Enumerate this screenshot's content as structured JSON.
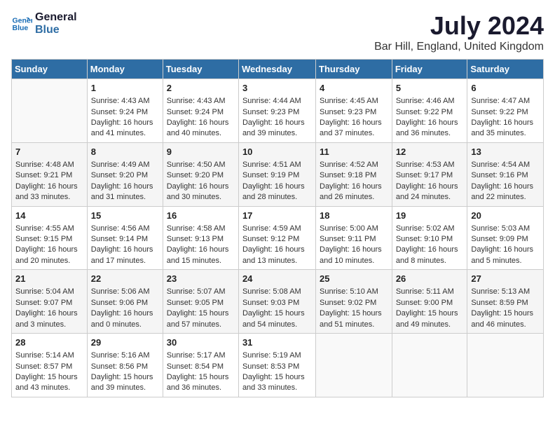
{
  "logo": {
    "line1": "General",
    "line2": "Blue"
  },
  "title": "July 2024",
  "location": "Bar Hill, England, United Kingdom",
  "days_of_week": [
    "Sunday",
    "Monday",
    "Tuesday",
    "Wednesday",
    "Thursday",
    "Friday",
    "Saturday"
  ],
  "weeks": [
    [
      {
        "day": "",
        "content": ""
      },
      {
        "day": "1",
        "content": "Sunrise: 4:43 AM\nSunset: 9:24 PM\nDaylight: 16 hours\nand 41 minutes."
      },
      {
        "day": "2",
        "content": "Sunrise: 4:43 AM\nSunset: 9:24 PM\nDaylight: 16 hours\nand 40 minutes."
      },
      {
        "day": "3",
        "content": "Sunrise: 4:44 AM\nSunset: 9:23 PM\nDaylight: 16 hours\nand 39 minutes."
      },
      {
        "day": "4",
        "content": "Sunrise: 4:45 AM\nSunset: 9:23 PM\nDaylight: 16 hours\nand 37 minutes."
      },
      {
        "day": "5",
        "content": "Sunrise: 4:46 AM\nSunset: 9:22 PM\nDaylight: 16 hours\nand 36 minutes."
      },
      {
        "day": "6",
        "content": "Sunrise: 4:47 AM\nSunset: 9:22 PM\nDaylight: 16 hours\nand 35 minutes."
      }
    ],
    [
      {
        "day": "7",
        "content": "Sunrise: 4:48 AM\nSunset: 9:21 PM\nDaylight: 16 hours\nand 33 minutes."
      },
      {
        "day": "8",
        "content": "Sunrise: 4:49 AM\nSunset: 9:20 PM\nDaylight: 16 hours\nand 31 minutes."
      },
      {
        "day": "9",
        "content": "Sunrise: 4:50 AM\nSunset: 9:20 PM\nDaylight: 16 hours\nand 30 minutes."
      },
      {
        "day": "10",
        "content": "Sunrise: 4:51 AM\nSunset: 9:19 PM\nDaylight: 16 hours\nand 28 minutes."
      },
      {
        "day": "11",
        "content": "Sunrise: 4:52 AM\nSunset: 9:18 PM\nDaylight: 16 hours\nand 26 minutes."
      },
      {
        "day": "12",
        "content": "Sunrise: 4:53 AM\nSunset: 9:17 PM\nDaylight: 16 hours\nand 24 minutes."
      },
      {
        "day": "13",
        "content": "Sunrise: 4:54 AM\nSunset: 9:16 PM\nDaylight: 16 hours\nand 22 minutes."
      }
    ],
    [
      {
        "day": "14",
        "content": "Sunrise: 4:55 AM\nSunset: 9:15 PM\nDaylight: 16 hours\nand 20 minutes."
      },
      {
        "day": "15",
        "content": "Sunrise: 4:56 AM\nSunset: 9:14 PM\nDaylight: 16 hours\nand 17 minutes."
      },
      {
        "day": "16",
        "content": "Sunrise: 4:58 AM\nSunset: 9:13 PM\nDaylight: 16 hours\nand 15 minutes."
      },
      {
        "day": "17",
        "content": "Sunrise: 4:59 AM\nSunset: 9:12 PM\nDaylight: 16 hours\nand 13 minutes."
      },
      {
        "day": "18",
        "content": "Sunrise: 5:00 AM\nSunset: 9:11 PM\nDaylight: 16 hours\nand 10 minutes."
      },
      {
        "day": "19",
        "content": "Sunrise: 5:02 AM\nSunset: 9:10 PM\nDaylight: 16 hours\nand 8 minutes."
      },
      {
        "day": "20",
        "content": "Sunrise: 5:03 AM\nSunset: 9:09 PM\nDaylight: 16 hours\nand 5 minutes."
      }
    ],
    [
      {
        "day": "21",
        "content": "Sunrise: 5:04 AM\nSunset: 9:07 PM\nDaylight: 16 hours\nand 3 minutes."
      },
      {
        "day": "22",
        "content": "Sunrise: 5:06 AM\nSunset: 9:06 PM\nDaylight: 16 hours\nand 0 minutes."
      },
      {
        "day": "23",
        "content": "Sunrise: 5:07 AM\nSunset: 9:05 PM\nDaylight: 15 hours\nand 57 minutes."
      },
      {
        "day": "24",
        "content": "Sunrise: 5:08 AM\nSunset: 9:03 PM\nDaylight: 15 hours\nand 54 minutes."
      },
      {
        "day": "25",
        "content": "Sunrise: 5:10 AM\nSunset: 9:02 PM\nDaylight: 15 hours\nand 51 minutes."
      },
      {
        "day": "26",
        "content": "Sunrise: 5:11 AM\nSunset: 9:00 PM\nDaylight: 15 hours\nand 49 minutes."
      },
      {
        "day": "27",
        "content": "Sunrise: 5:13 AM\nSunset: 8:59 PM\nDaylight: 15 hours\nand 46 minutes."
      }
    ],
    [
      {
        "day": "28",
        "content": "Sunrise: 5:14 AM\nSunset: 8:57 PM\nDaylight: 15 hours\nand 43 minutes."
      },
      {
        "day": "29",
        "content": "Sunrise: 5:16 AM\nSunset: 8:56 PM\nDaylight: 15 hours\nand 39 minutes."
      },
      {
        "day": "30",
        "content": "Sunrise: 5:17 AM\nSunset: 8:54 PM\nDaylight: 15 hours\nand 36 minutes."
      },
      {
        "day": "31",
        "content": "Sunrise: 5:19 AM\nSunset: 8:53 PM\nDaylight: 15 hours\nand 33 minutes."
      },
      {
        "day": "",
        "content": ""
      },
      {
        "day": "",
        "content": ""
      },
      {
        "day": "",
        "content": ""
      }
    ]
  ]
}
